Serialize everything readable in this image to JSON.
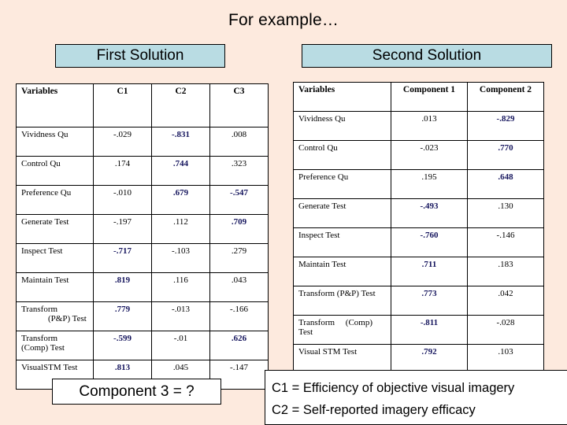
{
  "slide": {
    "title": "For example…",
    "background_color": "#fdeade",
    "header_box_color": "#b9dce3",
    "bold_value_color": "#16165e"
  },
  "first_solution": {
    "header_label": "First Solution",
    "columns": [
      "Variables",
      "C1",
      "C2",
      "C3"
    ],
    "rows": [
      {
        "variable": "Vividness Qu",
        "variable_line2": "",
        "values": [
          "-.029",
          "-.831",
          ".008"
        ],
        "bold": [
          false,
          true,
          false
        ]
      },
      {
        "variable": "Control Qu",
        "variable_line2": "",
        "values": [
          ".174",
          ".744",
          ".323"
        ],
        "bold": [
          false,
          true,
          false
        ]
      },
      {
        "variable": "Preference Qu",
        "variable_line2": "",
        "values": [
          "-.010",
          ".679",
          "-.547"
        ],
        "bold": [
          false,
          true,
          true
        ]
      },
      {
        "variable": "Generate Test",
        "variable_line2": "",
        "values": [
          "-.197",
          ".112",
          ".709"
        ],
        "bold": [
          false,
          false,
          true
        ]
      },
      {
        "variable": "Inspect Test",
        "variable_line2": "",
        "values": [
          "-.717",
          "-.103",
          ".279"
        ],
        "bold": [
          true,
          false,
          false
        ]
      },
      {
        "variable": "Maintain Test",
        "variable_line2": "",
        "values": [
          ".819",
          ".116",
          ".043"
        ],
        "bold": [
          true,
          false,
          false
        ]
      },
      {
        "variable": "Transform",
        "variable_line2": "(P&P) Test",
        "values": [
          ".779",
          "-.013",
          "-.166"
        ],
        "bold": [
          true,
          false,
          false
        ]
      },
      {
        "variable": "Transform",
        "variable_line2": "(Comp) Test",
        "values": [
          "-.599",
          "-.01",
          ".626"
        ],
        "bold": [
          true,
          false,
          true
        ]
      },
      {
        "variable": "VisualSTM Test",
        "variable_line2": "",
        "values": [
          ".813",
          ".045",
          "-.147"
        ],
        "bold": [
          true,
          false,
          false
        ]
      }
    ]
  },
  "second_solution": {
    "header_label": "Second Solution",
    "columns": [
      "Variables",
      "Component 1",
      "Component 2"
    ],
    "rows": [
      {
        "variable": "Vividness Qu",
        "variable_line2": "",
        "values": [
          ".013",
          "-.829"
        ],
        "bold": [
          false,
          true
        ]
      },
      {
        "variable": "Control Qu",
        "variable_line2": "",
        "values": [
          "-.023",
          ".770"
        ],
        "bold": [
          false,
          true
        ]
      },
      {
        "variable": "Preference Qu",
        "variable_line2": "",
        "values": [
          ".195",
          ".648"
        ],
        "bold": [
          false,
          true
        ]
      },
      {
        "variable": "Generate Test",
        "variable_line2": "",
        "values": [
          "-.493",
          ".130"
        ],
        "bold": [
          true,
          false
        ]
      },
      {
        "variable": "Inspect Test",
        "variable_line2": "",
        "values": [
          "-.760",
          "-.146"
        ],
        "bold": [
          true,
          false
        ]
      },
      {
        "variable": "Maintain Test",
        "variable_line2": "",
        "values": [
          ".711",
          ".183"
        ],
        "bold": [
          true,
          false
        ]
      },
      {
        "variable": "Transform (P&P) Test",
        "variable_line2": "",
        "values": [
          ".773",
          ".042"
        ],
        "bold": [
          true,
          false
        ]
      },
      {
        "variable": "Transform    (Comp)",
        "variable_line2": "Test",
        "values": [
          "-.811",
          "-.028"
        ],
        "bold": [
          true,
          false
        ]
      },
      {
        "variable": "Visual STM Test",
        "variable_line2": "",
        "values": [
          ".792",
          ".103"
        ],
        "bold": [
          true,
          false
        ]
      }
    ]
  },
  "footer": {
    "component3_label": "Component 3 = ?",
    "legend": [
      "C1 = Efficiency of objective visual imagery",
      "C2 = Self-reported imagery efficacy"
    ]
  }
}
